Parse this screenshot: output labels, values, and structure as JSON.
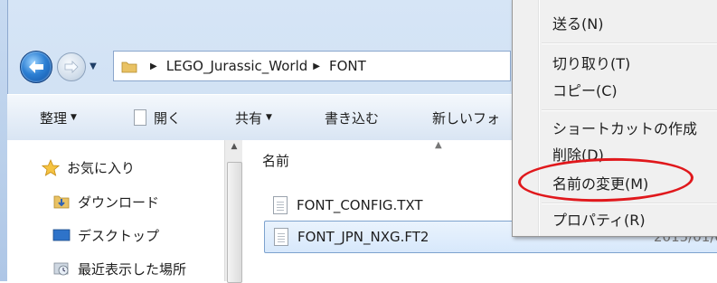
{
  "nav": {
    "back_icon": "back-arrow-icon",
    "forward_icon": "forward-arrow-icon"
  },
  "address": {
    "segments": [
      "LEGO_Jurassic_World",
      "FONT"
    ]
  },
  "toolbar": {
    "organize": "整理",
    "open": "開く",
    "share": "共有",
    "burn": "書き込む",
    "new_folder": "新しいフォ"
  },
  "sidebar": {
    "items": [
      {
        "label": "お気に入り",
        "icon": "star-icon"
      },
      {
        "label": "ダウンロード",
        "icon": "downloads-folder-icon"
      },
      {
        "label": "デスクトップ",
        "icon": "desktop-icon"
      },
      {
        "label": "最近表示した場所",
        "icon": "recent-places-icon"
      }
    ]
  },
  "content": {
    "column_name": "名前",
    "files": [
      {
        "name": "FONT_CONFIG.TXT",
        "date": ""
      },
      {
        "name": "FONT_JPN_NXG.FT2",
        "date": "2015/01/0"
      }
    ]
  },
  "context_menu": {
    "items": [
      {
        "label": "送る(N)"
      },
      {
        "label": "切り取り(T)"
      },
      {
        "label": "コピー(C)"
      },
      {
        "label": "ショートカットの作成"
      },
      {
        "label": "削除(D)"
      },
      {
        "label": "名前の変更(M)"
      },
      {
        "label": "プロパティ(R)"
      }
    ]
  },
  "colors": {
    "highlight_circle": "#e0181c",
    "selection": "#d7e8fb"
  }
}
